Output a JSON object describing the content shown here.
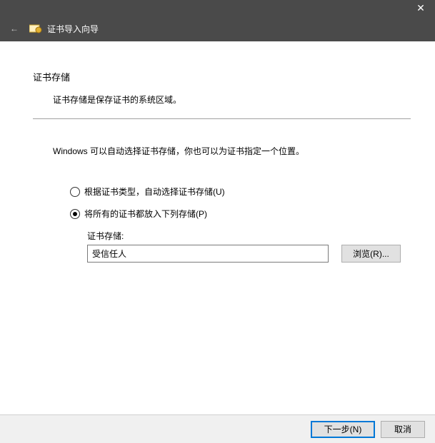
{
  "titlebar": {
    "close_glyph": "✕"
  },
  "header": {
    "back_glyph": "←",
    "wizard_title": "证书导入向导"
  },
  "content": {
    "heading": "证书存储",
    "subheading": "证书存储是保存证书的系统区域。",
    "description": "Windows 可以自动选择证书存储，你也可以为证书指定一个位置。",
    "radio": {
      "auto_label": "根据证书类型，自动选择证书存储(U)",
      "manual_label": "将所有的证书都放入下列存储(P)",
      "selected": "manual"
    },
    "store": {
      "label": "证书存储:",
      "value": "受信任人",
      "browse_label": "浏览(R)..."
    }
  },
  "footer": {
    "next_label": "下一步(N)",
    "cancel_label": "取消"
  }
}
